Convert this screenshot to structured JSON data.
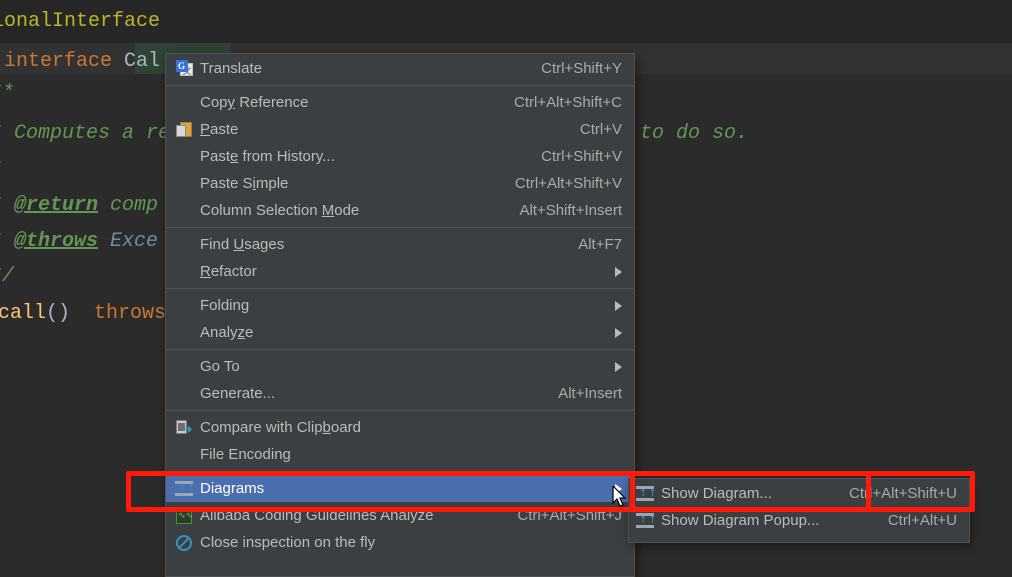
{
  "editor": {
    "lines": [
      {
        "id": "l1",
        "segments": [
          {
            "text": "ionalInterface",
            "style": "tok-annot"
          }
        ]
      },
      {
        "id": "l2",
        "segments": [
          {
            "text": " interface ",
            "style": "tok-kw"
          },
          {
            "text": "Cal",
            "style": "tok-type"
          }
        ]
      },
      {
        "id": "l3",
        "segments": [
          {
            "text": "**",
            "style": "tok-doc"
          }
        ]
      },
      {
        "id": "l4",
        "segments": [
          {
            "text": "* Computes a re",
            "style": "tok-doc"
          }
        ]
      },
      {
        "id": "l5",
        "segments": [
          {
            "text": "*",
            "style": "tok-doc"
          }
        ]
      },
      {
        "id": "l6",
        "segments": [
          {
            "text": "* ",
            "style": "tok-doc"
          },
          {
            "text": "@return",
            "style": "tok-doctag"
          },
          {
            "text": " comp",
            "style": "tok-doc"
          }
        ]
      },
      {
        "id": "l7",
        "segments": [
          {
            "text": "* ",
            "style": "tok-doc"
          },
          {
            "text": "@throws",
            "style": "tok-doctag"
          },
          {
            "text": " ",
            "style": "tok-doc"
          },
          {
            "text": "Exce",
            "style": "tok-docref"
          }
        ]
      },
      {
        "id": "l8",
        "segments": [
          {
            "text": "*/",
            "style": "tok-doc"
          }
        ]
      },
      {
        "id": "l9",
        "segments": [
          {
            "text": "call",
            "style": "tok-method"
          },
          {
            "text": "()",
            "style": "tok-paren"
          },
          {
            "text": "  throws",
            "style": "tok-kw"
          }
        ]
      }
    ],
    "right_fragment": "to do so."
  },
  "context_menu": {
    "name": "editor-context-menu",
    "items": [
      {
        "id": "translate",
        "label": "Translate",
        "accel": "Ctrl+Shift+Y",
        "icon": "translate-icon",
        "submenu": false,
        "separator_after": true
      },
      {
        "id": "copy-reference",
        "label": "Copy Reference",
        "accel": "Ctrl+Alt+Shift+C",
        "icon": "",
        "submenu": false,
        "mnemonic": "y"
      },
      {
        "id": "paste",
        "label": "Paste",
        "accel": "Ctrl+V",
        "icon": "paste-icon",
        "submenu": false,
        "mnemonic": "P"
      },
      {
        "id": "paste-from-history",
        "label": "Paste from History...",
        "accel": "Ctrl+Shift+V",
        "icon": "",
        "submenu": false,
        "mnemonic": "e"
      },
      {
        "id": "paste-simple",
        "label": "Paste Simple",
        "accel": "Ctrl+Alt+Shift+V",
        "icon": "",
        "submenu": false,
        "mnemonic": "i"
      },
      {
        "id": "column-selection-mode",
        "label": "Column Selection Mode",
        "accel": "Alt+Shift+Insert",
        "icon": "",
        "submenu": false,
        "mnemonic": "M",
        "separator_after": true
      },
      {
        "id": "find-usages",
        "label": "Find Usages",
        "accel": "Alt+F7",
        "icon": "",
        "submenu": false,
        "mnemonic": "U"
      },
      {
        "id": "refactor",
        "label": "Refactor",
        "accel": "",
        "icon": "",
        "submenu": true,
        "mnemonic": "R",
        "separator_after": true
      },
      {
        "id": "folding",
        "label": "Folding",
        "accel": "",
        "icon": "",
        "submenu": true
      },
      {
        "id": "analyze",
        "label": "Analyze",
        "accel": "",
        "icon": "",
        "submenu": true,
        "mnemonic": "z",
        "separator_after": true
      },
      {
        "id": "go-to",
        "label": "Go To",
        "accel": "",
        "icon": "",
        "submenu": true
      },
      {
        "id": "generate",
        "label": "Generate...",
        "accel": "Alt+Insert",
        "icon": "",
        "submenu": false,
        "separator_after": true
      },
      {
        "id": "compare-with-clipboard",
        "label": "Compare with Clipboard",
        "accel": "",
        "icon": "compare-clipboard-icon",
        "submenu": false,
        "mnemonic": "b"
      },
      {
        "id": "file-encoding",
        "label": "File Encoding",
        "accel": "",
        "icon": "",
        "submenu": false,
        "separator_after": true
      },
      {
        "id": "diagrams",
        "label": "Diagrams",
        "accel": "",
        "icon": "diagram-icon",
        "submenu": true,
        "selected": true
      },
      {
        "id": "alibaba-coding-guidelines-analyze",
        "label": "Alibaba Coding Guidelines Analyze",
        "accel": "Ctrl+Alt+Shift+J",
        "icon": "alibaba-icon",
        "submenu": false
      },
      {
        "id": "close-inspection-on-the-fly",
        "label": "Close inspection on the fly",
        "accel": "",
        "icon": "no-inspection-icon",
        "submenu": false
      }
    ]
  },
  "submenu": {
    "name": "diagrams-submenu",
    "items": [
      {
        "id": "show-diagram",
        "label": "Show Diagram...",
        "accel": "Ctrl+Alt+Shift+U",
        "icon": "diagram-icon"
      },
      {
        "id": "show-diagram-popup",
        "label": "Show Diagram Popup...",
        "accel": "Ctrl+Alt+U",
        "icon": "diagram-icon"
      }
    ]
  },
  "annotation": {
    "color": "#ff1a0a",
    "highlighted_items": [
      "Diagrams",
      "Show Diagram..."
    ]
  },
  "colors": {
    "menu_background": "#3c3f41",
    "menu_text": "#bbbbbb",
    "selection_blue": "#4b6eaf",
    "editor_background": "#2b2b2b",
    "caret_line": "#323232",
    "annotation_red": "#ff1a0a"
  }
}
